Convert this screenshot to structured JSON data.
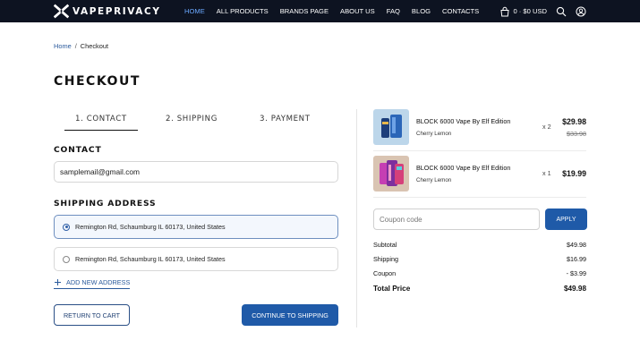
{
  "header": {
    "brand": "VAPEPRIVACY",
    "nav": [
      "HOME",
      "ALL PRODUCTS",
      "BRANDS PAGE",
      "ABOUT US",
      "FAQ",
      "BLOG",
      "CONTACTS"
    ],
    "active_nav": "HOME",
    "cart_summary": "0 · $0 USD",
    "icons": [
      "bag-icon",
      "search-icon",
      "account-icon"
    ]
  },
  "breadcrumb": {
    "home": "Home",
    "separator": "/",
    "current": "Checkout"
  },
  "page_title": "CHECKOUT",
  "steps": [
    "1. CONTACT",
    "2. SHIPPING",
    "3. PAYMENT"
  ],
  "contact": {
    "title": "CONTACT",
    "email": "samplemail@gmail.com"
  },
  "shipping": {
    "title": "SHIPPING ADDRESS",
    "addresses": [
      {
        "text": "Remington Rd, Schaumburg IL 60173, United States",
        "selected": true
      },
      {
        "text": "Remington Rd, Schaumburg IL 60173, United States",
        "selected": false
      }
    ],
    "add_new": "ADD NEW ADDRESS"
  },
  "buttons": {
    "return": "RETURN TO CART",
    "continue": "CONTINUE TO SHIPPING",
    "apply": "APPLY"
  },
  "order": {
    "items": [
      {
        "name": "BLOCK 6000 Vape By Elf Edition",
        "variant": "Cherry Lemon",
        "qty": "x 2",
        "price": "$29.98",
        "old_price": "$33.98"
      },
      {
        "name": "BLOCK 6000 Vape By Elf Edition",
        "variant": "Cherry Lemon",
        "qty": "x 1",
        "price": "$19.99"
      }
    ],
    "coupon_placeholder": "Coupon code",
    "summary": {
      "subtotal_label": "Subtotal",
      "subtotal": "$49.98",
      "shipping_label": "Shipping",
      "shipping": "$16.99",
      "coupon_label": "Coupon",
      "coupon": "- $3.99",
      "total_label": "Total Price",
      "total": "$49.98"
    }
  },
  "colors": {
    "header_bg": "#0d1321",
    "accent": "#1f5aa8",
    "active_nav": "#6aa8ff"
  }
}
